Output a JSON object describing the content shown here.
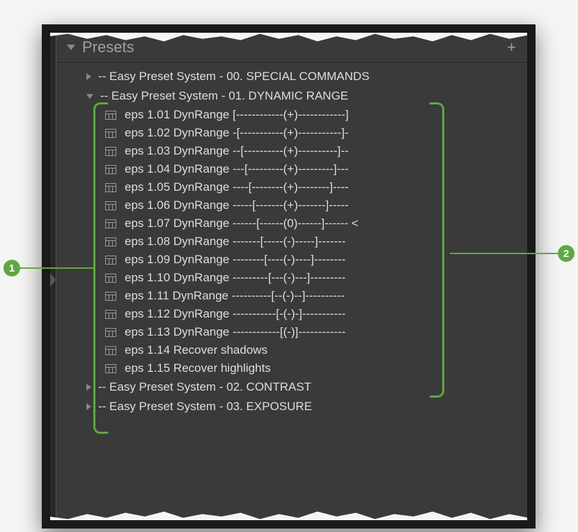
{
  "panel": {
    "title": "Presets"
  },
  "folders": [
    {
      "expanded": false,
      "label": "-- Easy Preset System - 00. SPECIAL COMMANDS"
    },
    {
      "expanded": true,
      "label": "-- Easy Preset System - 01. DYNAMIC RANGE"
    },
    {
      "expanded": false,
      "label": "-- Easy Preset System - 02. CONTRAST"
    },
    {
      "expanded": false,
      "label": "-- Easy Preset System - 03. EXPOSURE"
    }
  ],
  "presets": [
    "eps 1.01 DynRange [------------(+)------------]",
    "eps 1.02 DynRange -[-----------(+)-----------]-",
    "eps 1.03 DynRange --[----------(+)----------]--",
    "eps 1.04 DynRange ---[---------(+)---------]---",
    "eps 1.05 DynRange ----[--------(+)--------]----",
    "eps 1.06 DynRange -----[-------(+)-------]-----",
    "eps 1.07 DynRange ------[------(0)------]------ <",
    "eps 1.08 DynRange -------[-----(-)-----]-------",
    "eps 1.09 DynRange --------[----(-)----]--------",
    "eps 1.10 DynRange ---------[---(-)---]---------",
    "eps 1.11 DynRange ----------[--(-)--]----------",
    "eps 1.12 DynRange -----------[-(-)-]-----------",
    "eps 1.13 DynRange ------------[(-)]------------",
    "eps 1.14 Recover shadows",
    "eps 1.15 Recover highlights"
  ],
  "annotations": {
    "label1": "1",
    "label2": "2"
  }
}
